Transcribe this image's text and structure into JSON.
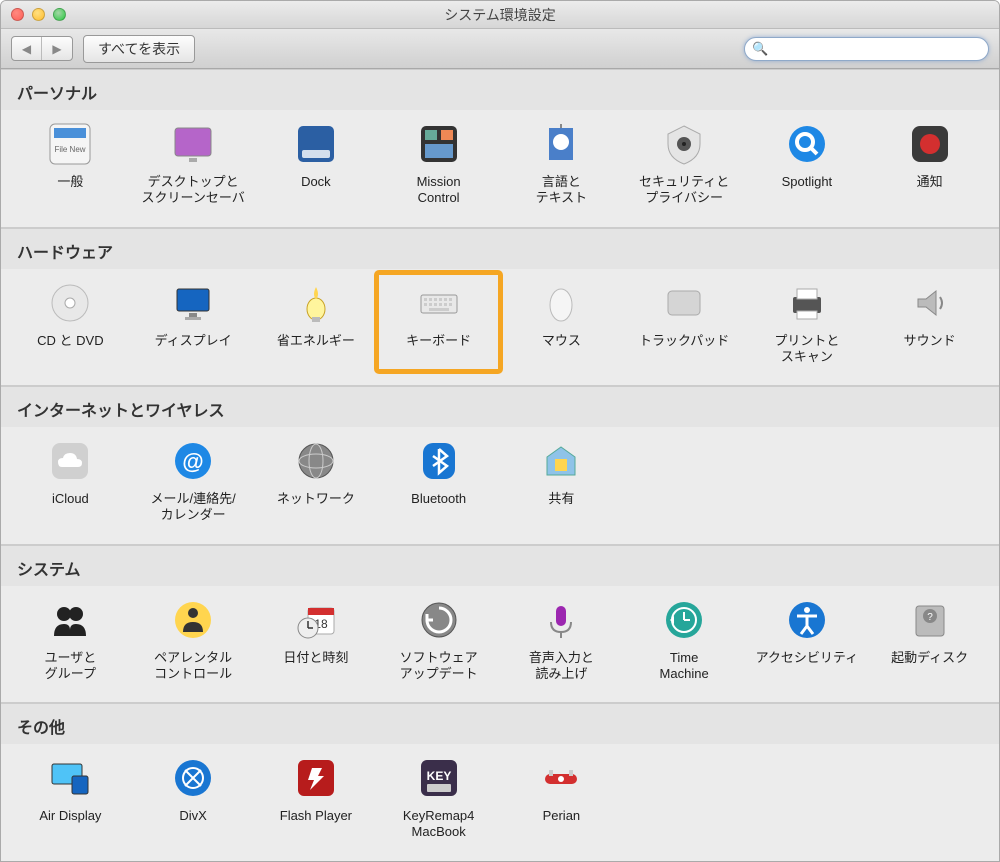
{
  "window": {
    "title": "システム環境設定"
  },
  "toolbar": {
    "show_all": "すべてを表示",
    "search_placeholder": ""
  },
  "sections": {
    "personal": {
      "title": "パーソナル",
      "items": [
        {
          "name": "general",
          "label": "一般"
        },
        {
          "name": "desktop-screensaver",
          "label": "デスクトップと\nスクリーンセーバ"
        },
        {
          "name": "dock",
          "label": "Dock"
        },
        {
          "name": "mission-control",
          "label": "Mission\nControl"
        },
        {
          "name": "language-text",
          "label": "言語と\nテキスト"
        },
        {
          "name": "security-privacy",
          "label": "セキュリティと\nプライバシー"
        },
        {
          "name": "spotlight",
          "label": "Spotlight"
        },
        {
          "name": "notifications",
          "label": "通知"
        }
      ]
    },
    "hardware": {
      "title": "ハードウェア",
      "items": [
        {
          "name": "cd-dvd",
          "label": "CD と DVD"
        },
        {
          "name": "displays",
          "label": "ディスプレイ"
        },
        {
          "name": "energy-saver",
          "label": "省エネルギー"
        },
        {
          "name": "keyboard",
          "label": "キーボード",
          "highlight": true
        },
        {
          "name": "mouse",
          "label": "マウス"
        },
        {
          "name": "trackpad",
          "label": "トラックパッド"
        },
        {
          "name": "print-scan",
          "label": "プリントと\nスキャン"
        },
        {
          "name": "sound",
          "label": "サウンド"
        }
      ]
    },
    "internet": {
      "title": "インターネットとワイヤレス",
      "items": [
        {
          "name": "icloud",
          "label": "iCloud"
        },
        {
          "name": "mail-contacts-calendars",
          "label": "メール/連絡先/\nカレンダー"
        },
        {
          "name": "network",
          "label": "ネットワーク"
        },
        {
          "name": "bluetooth",
          "label": "Bluetooth"
        },
        {
          "name": "sharing",
          "label": "共有"
        }
      ]
    },
    "system": {
      "title": "システム",
      "items": [
        {
          "name": "users-groups",
          "label": "ユーザと\nグループ"
        },
        {
          "name": "parental-controls",
          "label": "ペアレンタル\nコントロール"
        },
        {
          "name": "date-time",
          "label": "日付と時刻"
        },
        {
          "name": "software-update",
          "label": "ソフトウェア\nアップデート"
        },
        {
          "name": "dictation-speech",
          "label": "音声入力と\n読み上げ"
        },
        {
          "name": "time-machine",
          "label": "Time\nMachine"
        },
        {
          "name": "accessibility",
          "label": "アクセシビリティ"
        },
        {
          "name": "startup-disk",
          "label": "起動ディスク"
        }
      ]
    },
    "other": {
      "title": "その他",
      "items": [
        {
          "name": "air-display",
          "label": "Air Display"
        },
        {
          "name": "divx",
          "label": "DivX"
        },
        {
          "name": "flash-player",
          "label": "Flash Player"
        },
        {
          "name": "keyremap4macbook",
          "label": "KeyRemap4\nMacBook"
        },
        {
          "name": "perian",
          "label": "Perian"
        }
      ]
    }
  }
}
